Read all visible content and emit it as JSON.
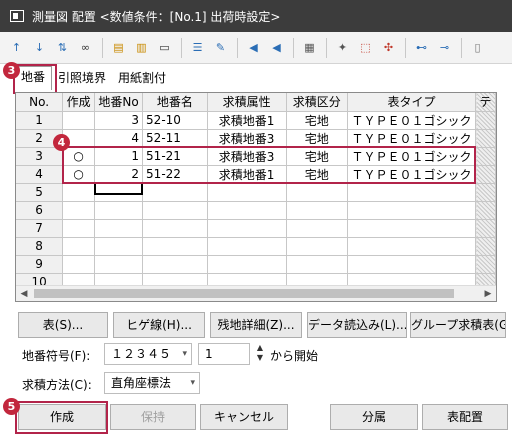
{
  "window": {
    "title": "測量図 配置 <数値条件：[No.1] 出荷時設定>"
  },
  "toolbar": {
    "icons": [
      "arrow-up-icon",
      "arrow-down-icon",
      "sort-icon",
      "binoculars-icon",
      "column-insert-icon",
      "column-copy-icon",
      "field-icon",
      "list-icon",
      "edit-icon",
      "speaker-icon",
      "speaker-settings-icon",
      "grid-icon",
      "pin-icon",
      "select-icon",
      "tool-icon",
      "link-icon",
      "link-right-icon",
      "doc-icon"
    ]
  },
  "tabs": [
    {
      "label": "地番"
    },
    {
      "label": "引照境界"
    },
    {
      "label": "用紙割付"
    }
  ],
  "badges": {
    "b3": "3",
    "b4": "4",
    "b5": "5"
  },
  "grid": {
    "headers": [
      "No.",
      "作成",
      "地番No",
      "地番名",
      "求積属性",
      "求積区分",
      "表タイプ",
      "テ"
    ],
    "rows": [
      {
        "no": "1",
        "make": "",
        "chiban_no": "3",
        "name": "52-10",
        "attr": "求積地番1",
        "kubun": "宅地",
        "type": "ＴＹＰＥ０１ゴシック"
      },
      {
        "no": "2",
        "make": "",
        "chiban_no": "4",
        "name": "52-11",
        "attr": "求積地番3",
        "kubun": "宅地",
        "type": "ＴＹＰＥ０１ゴシック"
      },
      {
        "no": "3",
        "make": "○",
        "chiban_no": "1",
        "name": "51-21",
        "attr": "求積地番3",
        "kubun": "宅地",
        "type": "ＴＹＰＥ０１ゴシック"
      },
      {
        "no": "4",
        "make": "○",
        "chiban_no": "2",
        "name": "51-22",
        "attr": "求積地番1",
        "kubun": "宅地",
        "type": "ＴＹＰＥ０１ゴシック"
      },
      {
        "no": "5",
        "make": "",
        "chiban_no": "",
        "name": "",
        "attr": "",
        "kubun": "",
        "type": ""
      },
      {
        "no": "6",
        "make": "",
        "chiban_no": "",
        "name": "",
        "attr": "",
        "kubun": "",
        "type": ""
      },
      {
        "no": "7",
        "make": "",
        "chiban_no": "",
        "name": "",
        "attr": "",
        "kubun": "",
        "type": ""
      },
      {
        "no": "8",
        "make": "",
        "chiban_no": "",
        "name": "",
        "attr": "",
        "kubun": "",
        "type": ""
      },
      {
        "no": "9",
        "make": "",
        "chiban_no": "",
        "name": "",
        "attr": "",
        "kubun": "",
        "type": ""
      },
      {
        "no": "10",
        "make": "",
        "chiban_no": "",
        "name": "",
        "attr": "",
        "kubun": "",
        "type": ""
      }
    ]
  },
  "buttons_row1": {
    "table": "表(S)...",
    "hige": "ヒゲ線(H)...",
    "zanchi": "残地詳細(Z)...",
    "import": "データ読込み(L)...",
    "group": "グループ求積表(G"
  },
  "form": {
    "chiban_label": "地番符号(F):",
    "chiban_value": "１２３４５",
    "start_value": "1",
    "start_suffix": "から開始",
    "method_label": "求積方法(C):",
    "method_value": "直角座標法"
  },
  "footer": {
    "create": "作成",
    "hold": "保持",
    "cancel": "キャンセル",
    "bunzoku": "分属",
    "layout": "表配置"
  }
}
